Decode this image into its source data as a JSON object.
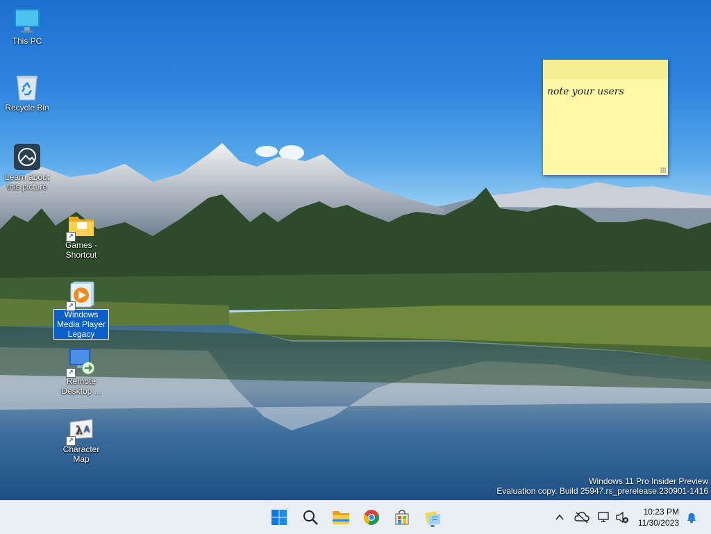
{
  "desktop": {
    "icons": [
      {
        "id": "this-pc",
        "label": "This PC",
        "icon": "monitor-icon",
        "shortcut": false,
        "selected": false
      },
      {
        "id": "recycle-bin",
        "label": "Recycle Bin",
        "icon": "recycle-bin-icon",
        "shortcut": false,
        "selected": false
      },
      {
        "id": "learn-about",
        "label": "Learn about this picture",
        "icon": "camera-lens-icon",
        "shortcut": false,
        "selected": false
      },
      {
        "id": "games",
        "label": "Games - Shortcut",
        "icon": "folder-icon",
        "shortcut": true,
        "selected": false
      },
      {
        "id": "wmp",
        "label": "Windows Media Player Legacy",
        "icon": "media-player-icon",
        "shortcut": true,
        "selected": true
      },
      {
        "id": "remote",
        "label": "Remote Desktop ...",
        "icon": "remote-desktop-icon",
        "shortcut": true,
        "selected": false
      },
      {
        "id": "charmap",
        "label": "Character Map",
        "icon": "character-map-icon",
        "shortcut": true,
        "selected": false
      }
    ]
  },
  "sticky_note": {
    "text": "note your users",
    "color": "#fdf8a6"
  },
  "watermark": {
    "line1": "Windows 11 Pro Insider Preview",
    "line2": "Evaluation copy. Build 25947.rs_prerelease.230901-1416"
  },
  "taskbar": {
    "apps": [
      {
        "name": "start-button",
        "icon": "windows-logo-icon"
      },
      {
        "name": "search-button",
        "icon": "search-icon"
      },
      {
        "name": "file-explorer-button",
        "icon": "folder-icon"
      },
      {
        "name": "chrome-button",
        "icon": "chrome-icon"
      },
      {
        "name": "store-button",
        "icon": "store-icon"
      },
      {
        "name": "sticky-notes-button",
        "icon": "sticky-notes-icon",
        "active": true
      }
    ],
    "tray": {
      "time": "10:23 PM",
      "date": "11/30/2023"
    }
  },
  "colors": {
    "selection": "#0a5fc9",
    "taskbar": "#e9eef4",
    "accent": "#0078d4"
  }
}
